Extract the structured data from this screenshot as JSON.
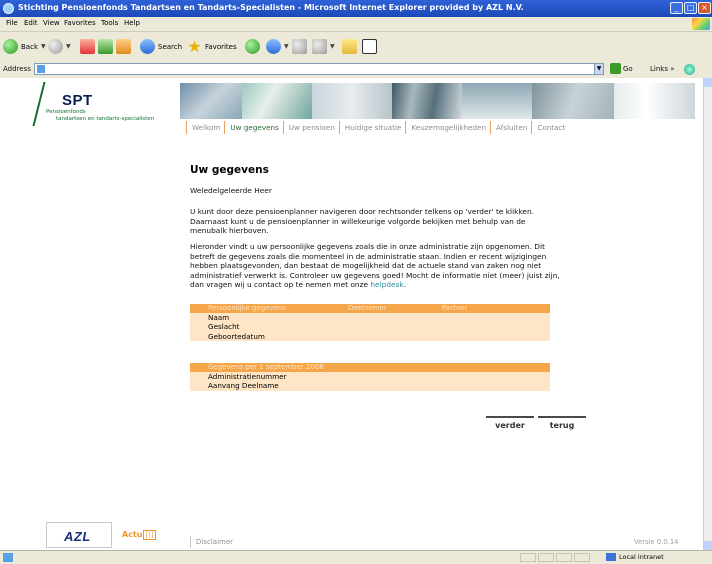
{
  "window": {
    "title": "Stichting Pensioenfonds Tandartsen en Tandarts-Specialisten - Microsoft Internet Explorer provided by AZL N.V.",
    "controls": [
      "_",
      "□",
      "×"
    ]
  },
  "menu": [
    "File",
    "Edit",
    "View",
    "Favorites",
    "Tools",
    "Help"
  ],
  "toolbar": {
    "back_label": "Back",
    "search_label": "Search",
    "favorites_label": "Favorites"
  },
  "address": {
    "label": "Address",
    "value": "",
    "go_label": "Go",
    "links_label": "Links",
    "chevron": "»"
  },
  "logo": {
    "name": "SPT",
    "sub1": "Pensioenfonds",
    "sub2": "tandartsen en tandarts-specialisten"
  },
  "nav": {
    "items": [
      "Welkom",
      "Uw gegevens",
      "Uw pensioen",
      "Huidige situatie",
      "Keuzemogelijkheden",
      "Afsluiten",
      "Contact"
    ],
    "active_index": 1
  },
  "content": {
    "title": "Uw gegevens",
    "salutation": "Weledelgeleerde Heer",
    "para1_line1": "U kunt door deze pensioenplanner navigeren door rechtsonder telkens op 'verder' te klikken.",
    "para1_line2": "Daarnaast kunt u de pensioenplanner in willekeurige volgorde bekijken met behulp van de",
    "para1_line3": "menubalk hierboven.",
    "para2_line1": "Hieronder vindt u uw persoonlijke gegevens zoals die in onze administratie zijn opgenomen. Dit",
    "para2_line2": "betreft de gegevens zoals die momenteel in de administratie staan. Indien er recent wijzigingen",
    "para2_line3": "hebben plaatsgevonden, dan bestaat de mogelijkheid dat de actuele stand van zaken nog niet",
    "para2_line4": "administratief verwerkt is. Controleer uw gegevens goed! Mocht de informatie niet (meer) juist zijn,",
    "para2_line5_pre": "dan vragen wij u contact op te nemen met onze ",
    "helpdesk": "helpdesk",
    "para2_line5_post": "."
  },
  "table1": {
    "headers": [
      "Persoonlijke gegevens",
      "Deelnemer",
      "Partner"
    ],
    "rows": [
      "Naam",
      "Geslacht",
      "Geboortedatum"
    ]
  },
  "table2": {
    "header": "Gegevens per 1 september 2008",
    "rows": [
      "Administratienummer",
      "Aanvang Deelname"
    ]
  },
  "buttons": {
    "next": "verder",
    "back": "terug"
  },
  "footer": {
    "azl": "AZL",
    "actu": "Actu",
    "actu_bracket": "[!]",
    "disclaimer": "Disclaimer",
    "version": "Versie 0.0.14"
  },
  "status": {
    "zone": "Local intranet"
  },
  "colors": {
    "accent_orange": "#f6a64a",
    "row_peach": "#fde5c6",
    "brand_green": "#0d6f33",
    "brand_navy": "#0a1e52",
    "link_teal": "#2f8d98"
  }
}
